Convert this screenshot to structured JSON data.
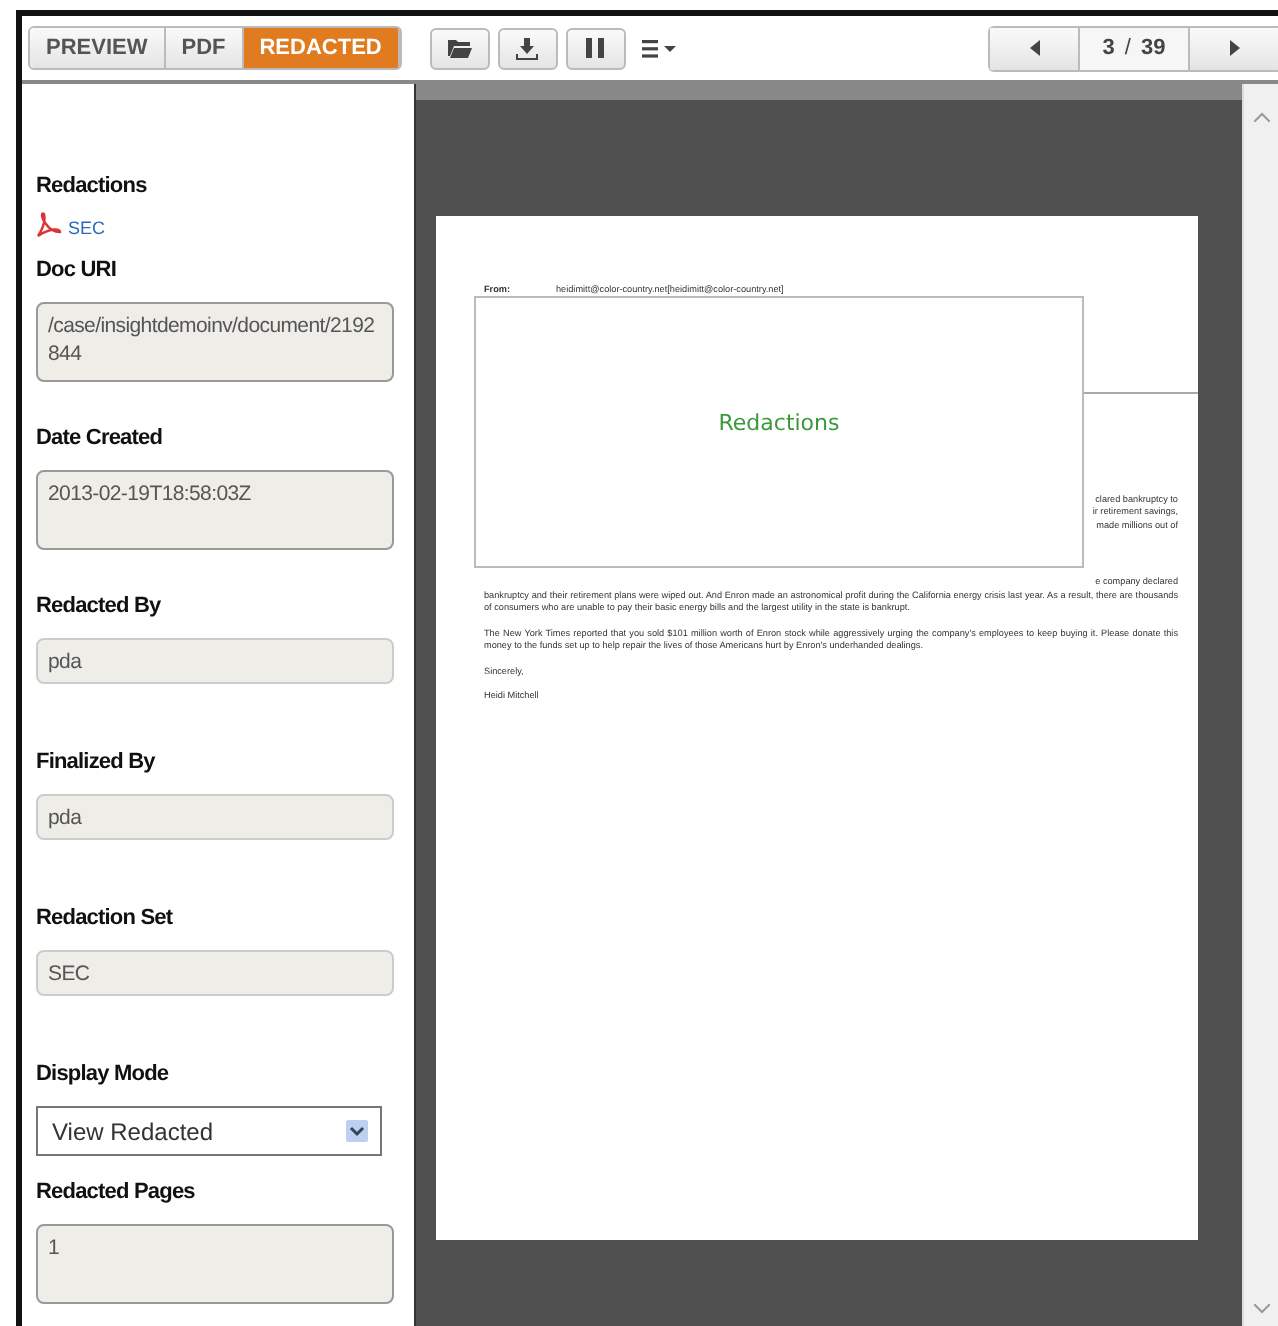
{
  "view_tabs": [
    {
      "label": "PREVIEW",
      "selected": false
    },
    {
      "label": "PDF",
      "selected": false
    },
    {
      "label": "REDACTED",
      "selected": true
    }
  ],
  "pager": {
    "page": "3",
    "separator": "/",
    "total": "39"
  },
  "sidebar": {
    "redactions_label": "Redactions",
    "redaction_link": "SEC",
    "fields": [
      {
        "label": "Doc URI",
        "kind": "area",
        "value": "/case/insightdemoinv/document/2192844"
      },
      {
        "label": "Date Created",
        "kind": "area",
        "value": "2013-02-19T18:58:03Z"
      },
      {
        "label": "Redacted By",
        "kind": "text",
        "value": "pda"
      },
      {
        "label": "Finalized By",
        "kind": "text",
        "value": "pda"
      },
      {
        "label": "Redaction Set",
        "kind": "text",
        "value": "SEC"
      },
      {
        "label": "Display Mode",
        "kind": "select",
        "value": "View Redacted"
      },
      {
        "label": "Redacted Pages",
        "kind": "area",
        "value": "1"
      }
    ]
  },
  "document": {
    "from_label": "From:",
    "from_value": "heidimitt@color-country.net[heidimitt@color-country.net]",
    "overlay_title": "Redactions",
    "fragments": [
      "clared bankruptcy to",
      "ir retirement savings,",
      "made millions out of",
      "e company declared"
    ],
    "paragraphs": [
      "bankruptcy and their retirement plans were wiped out. And Enron made an astronomical profit during the California energy crisis last year. As a result, there are thousands of consumers who are unable to pay their basic energy bills and the largest utility in the state is bankrupt.",
      "The New York Times reported that you sold $101 million worth of Enron stock while aggressively urging the company's employees to keep buying it. Please donate this money to the funds set up to help repair the lives of those Americans hurt by Enron's underhanded dealings.",
      "Sincerely,",
      "Heidi Mitchell"
    ]
  }
}
